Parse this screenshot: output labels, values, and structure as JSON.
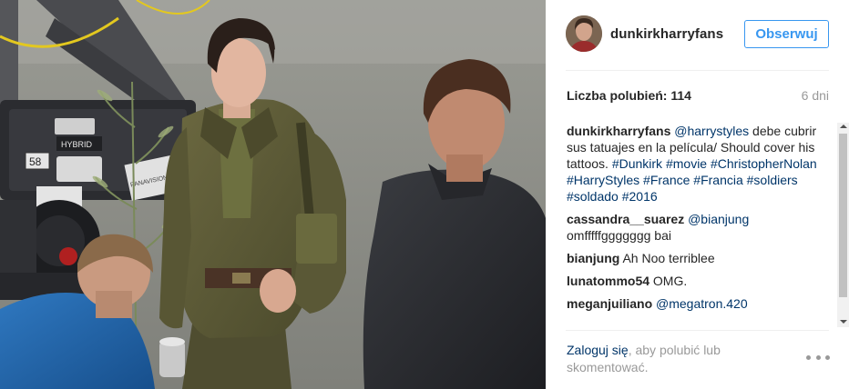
{
  "post": {
    "image_alt": "Dunkirk film set photo",
    "author": "dunkirkharryfans",
    "follow_label": "Obserwuj",
    "likes_label": "Liczba polubień: 114",
    "time_ago": "6 dni"
  },
  "comments": [
    {
      "author": "dunkirkharryfans",
      "segments": [
        {
          "text": "@harrystyles",
          "link": true
        },
        {
          "text": " debe cubrir sus tatuajes en la película/ Should cover his tattoos. ",
          "link": false
        },
        {
          "text": "#Dunkirk",
          "link": true
        },
        {
          "text": " ",
          "link": false
        },
        {
          "text": "#movie",
          "link": true
        },
        {
          "text": " ",
          "link": false
        },
        {
          "text": "#ChristopherNolan",
          "link": true
        },
        {
          "text": " ",
          "link": false
        },
        {
          "text": "#HarryStyles",
          "link": true
        },
        {
          "text": " ",
          "link": false
        },
        {
          "text": "#France",
          "link": true
        },
        {
          "text": " ",
          "link": false
        },
        {
          "text": "#Francia",
          "link": true
        },
        {
          "text": " ",
          "link": false
        },
        {
          "text": "#soldiers",
          "link": true
        },
        {
          "text": " ",
          "link": false
        },
        {
          "text": "#soldado",
          "link": true
        },
        {
          "text": " ",
          "link": false
        },
        {
          "text": "#2016",
          "link": true
        }
      ]
    },
    {
      "author": "cassandra__suarez",
      "segments": [
        {
          "text": "@bianjung",
          "link": true
        },
        {
          "text": " omfffffggggggg bai",
          "link": false
        }
      ]
    },
    {
      "author": "bianjung",
      "segments": [
        {
          "text": "Ah Noo terriblee",
          "link": false
        }
      ]
    },
    {
      "author": "lunatommo54",
      "segments": [
        {
          "text": "OMG.",
          "link": false
        }
      ]
    },
    {
      "author": "meganjuiliano",
      "segments": [
        {
          "text": "@megatron.420",
          "link": true
        }
      ]
    }
  ],
  "footer": {
    "login_link": "Zaloguj się",
    "login_rest": ", aby polubić lub skomentować."
  },
  "photo_text": {
    "camera_label": "HYBRID",
    "number_tag": "58",
    "brand": "PANAVISION"
  },
  "colors": {
    "link": "#003569",
    "accent": "#3897f0",
    "muted": "#999999"
  }
}
